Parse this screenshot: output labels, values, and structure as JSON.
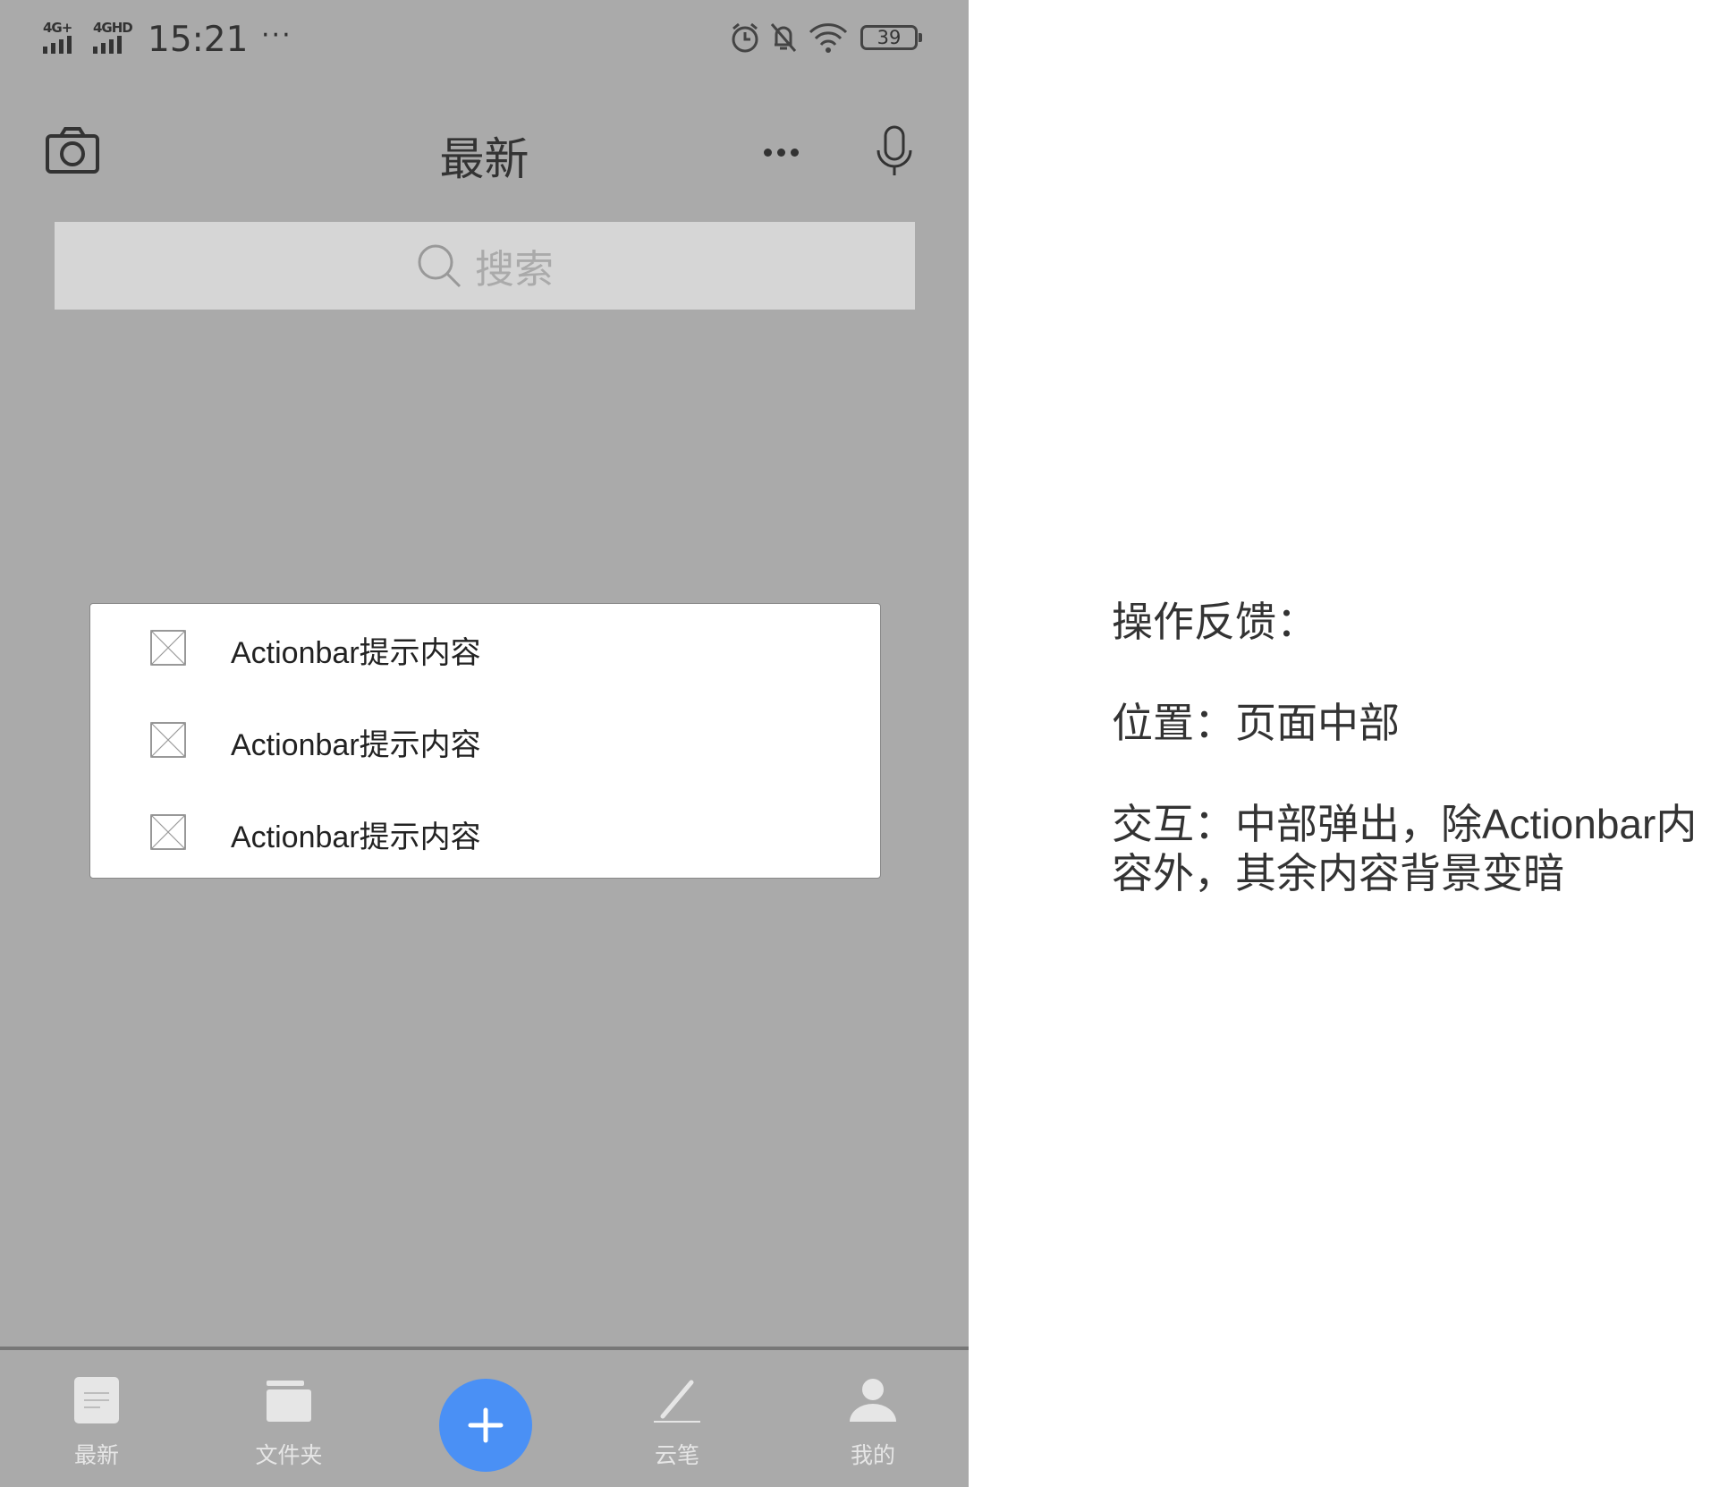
{
  "status_bar": {
    "network_1": "4G+",
    "network_2": "4GHD",
    "time": "15:21",
    "more": "···",
    "battery": "39",
    "icons": [
      "alarm-icon",
      "bell-off-icon",
      "wifi-icon",
      "battery-icon"
    ]
  },
  "header": {
    "title": "最新",
    "left_icon": "camera-icon",
    "right_icons": [
      "more-icon",
      "microphone-icon"
    ]
  },
  "search": {
    "placeholder": "搜索",
    "icon": "search-icon"
  },
  "action_bar": {
    "items": [
      {
        "label": "Actionbar提示内容",
        "icon": "placeholder-image-icon"
      },
      {
        "label": "Actionbar提示内容",
        "icon": "placeholder-image-icon"
      },
      {
        "label": "Actionbar提示内容",
        "icon": "placeholder-image-icon"
      }
    ]
  },
  "bottom_nav": {
    "items": [
      {
        "label": "最新",
        "icon": "document-icon"
      },
      {
        "label": "文件夹",
        "icon": "folder-icon"
      },
      {
        "label": "云笔",
        "icon": "pen-icon"
      },
      {
        "label": "我的",
        "icon": "user-icon"
      }
    ],
    "fab_icon": "plus-icon"
  },
  "annotation": {
    "heading": "操作反馈：",
    "position": "位置：页面中部",
    "interaction_line1": "交互：中部弹出，除Actionbar内",
    "interaction_line2": "容外，其余内容背景变暗"
  },
  "colors": {
    "overlay_background": "#aaaaaa",
    "fab": "#4a90f5",
    "popup": "#ffffff"
  }
}
